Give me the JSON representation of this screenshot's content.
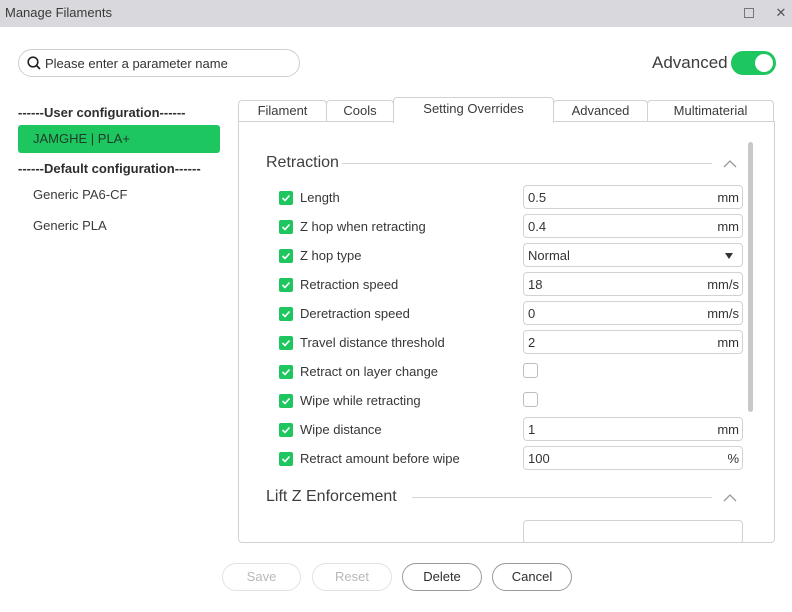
{
  "window": {
    "title": "Manage Filaments",
    "maximize_icon": "maximize-icon",
    "close_glyph": "✕"
  },
  "search": {
    "placeholder": "Please enter a parameter name",
    "value": "",
    "icon": "search-icon"
  },
  "advanced_toggle": {
    "label": "Advanced",
    "on": true,
    "color": "#1ec65f"
  },
  "sidebar": {
    "user_header": "------User configuration------",
    "user_items": [
      {
        "label": "JAMGHE | PLA+",
        "selected": true
      }
    ],
    "default_header": "------Default configuration------",
    "default_items": [
      {
        "label": "Generic PA6-CF"
      },
      {
        "label": "Generic PLA"
      }
    ]
  },
  "tabs": [
    {
      "label": "Filament"
    },
    {
      "label": "Cools"
    },
    {
      "label": "Setting Overrides",
      "active": true
    },
    {
      "label": "Advanced"
    },
    {
      "label": "Multimaterial"
    }
  ],
  "sections": [
    {
      "title": "Retraction",
      "expanded": true,
      "rows": [
        {
          "label": "Length",
          "checked": true,
          "type": "number",
          "value": "0.5",
          "unit": "mm"
        },
        {
          "label": "Z hop when retracting",
          "checked": true,
          "type": "number",
          "value": "0.4",
          "unit": "mm"
        },
        {
          "label": "Z hop type",
          "checked": true,
          "type": "select",
          "value": "Normal"
        },
        {
          "label": "Retraction speed",
          "checked": true,
          "type": "number",
          "value": "18",
          "unit": "mm/s"
        },
        {
          "label": "Deretraction speed",
          "checked": true,
          "type": "number",
          "value": "0",
          "unit": "mm/s"
        },
        {
          "label": "Travel distance threshold",
          "checked": true,
          "type": "number",
          "value": "2",
          "unit": "mm"
        },
        {
          "label": "Retract on layer change",
          "checked": true,
          "type": "checkbox",
          "value": false
        },
        {
          "label": "Wipe while retracting",
          "checked": true,
          "type": "checkbox",
          "value": false
        },
        {
          "label": "Wipe distance",
          "checked": true,
          "type": "number",
          "value": "1",
          "unit": "mm"
        },
        {
          "label": "Retract amount before wipe",
          "checked": true,
          "type": "number",
          "value": "100",
          "unit": "%"
        }
      ]
    },
    {
      "title": "Lift Z Enforcement",
      "expanded": true,
      "rows": []
    }
  ],
  "buttons": {
    "save": {
      "label": "Save",
      "enabled": false
    },
    "reset": {
      "label": "Reset",
      "enabled": false
    },
    "delete": {
      "label": "Delete",
      "enabled": true
    },
    "cancel": {
      "label": "Cancel",
      "enabled": true
    }
  },
  "colors": {
    "accent": "#1ec65f",
    "titlebar": "#d8d8dd"
  }
}
